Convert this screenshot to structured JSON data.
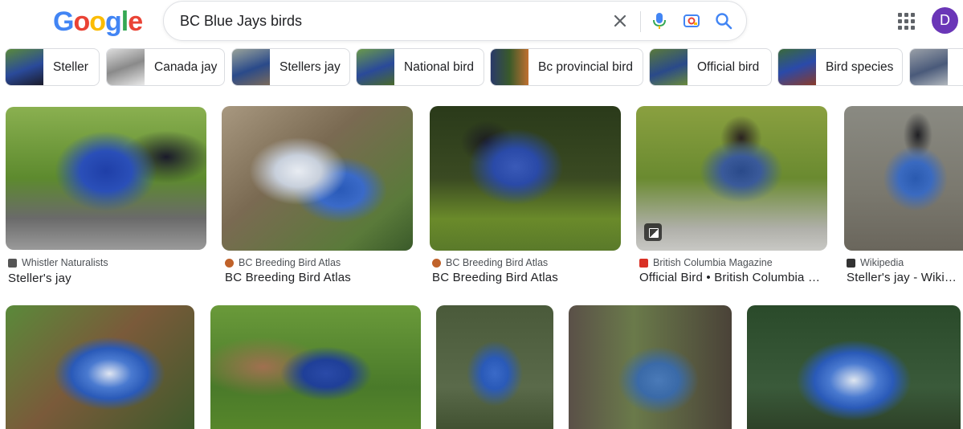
{
  "logo": {
    "letters": [
      "G",
      "o",
      "o",
      "g",
      "l",
      "e"
    ],
    "colors": [
      "#4285F4",
      "#EA4335",
      "#FBBC05",
      "#4285F4",
      "#34A853",
      "#EA4335"
    ]
  },
  "search": {
    "value": "BC Blue Jays birds"
  },
  "header": {
    "avatar_letter": "D",
    "avatar_color": "#6a36b7",
    "icons": [
      "close-icon",
      "microphone-icon",
      "camera-lens-icon",
      "search-icon",
      "apps-grid-icon"
    ]
  },
  "chips": [
    {
      "label": "Steller"
    },
    {
      "label": "Canada jay"
    },
    {
      "label": "Stellers jay"
    },
    {
      "label": "National bird"
    },
    {
      "label": "Bc provincial bird"
    },
    {
      "label": "Official bird"
    },
    {
      "label": "Bird species"
    },
    {
      "label": ""
    }
  ],
  "results_row1": [
    {
      "source": "Whistler Naturalists",
      "title": "Steller's jay",
      "favicon_color": "#555555"
    },
    {
      "source": "BC Breeding Bird Atlas",
      "title": "BC Breeding Bird Atlas",
      "favicon_color": "#c0622a"
    },
    {
      "source": "BC Breeding Bird Atlas",
      "title": "BC Breeding Bird Atlas",
      "favicon_color": "#c0622a"
    },
    {
      "source": "British Columbia Magazine",
      "title": "Official Bird • British Columbia Ma…",
      "favicon_color": "#d93025"
    },
    {
      "source": "Wikipedia",
      "title": "Steller's jay - Wikipe…",
      "favicon_color": "#333333"
    }
  ]
}
